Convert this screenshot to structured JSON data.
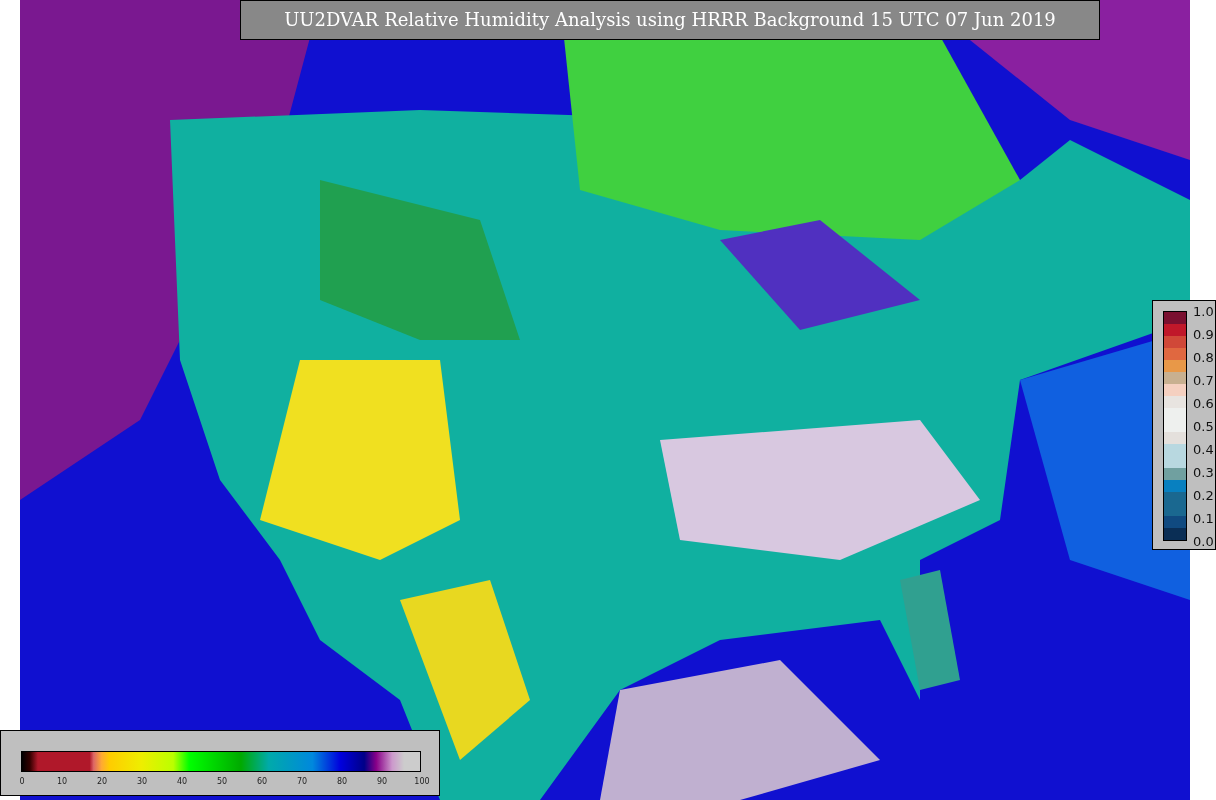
{
  "title": "UU2DVAR Relative Humidity Analysis using HRRR Background 15 UTC 07 Jun 2019",
  "colorbars": [
    {
      "kind": "horizontal",
      "ticks": [
        "0",
        "10",
        "20",
        "30",
        "40",
        "50",
        "60",
        "70",
        "80",
        "90",
        "100"
      ]
    },
    {
      "kind": "vertical",
      "ticks": [
        "1.0",
        "0.9",
        "0.8",
        "0.7",
        "0.6",
        "0.5",
        "0.4",
        "0.3",
        "0.2",
        "0.1",
        "0.0"
      ]
    }
  ]
}
